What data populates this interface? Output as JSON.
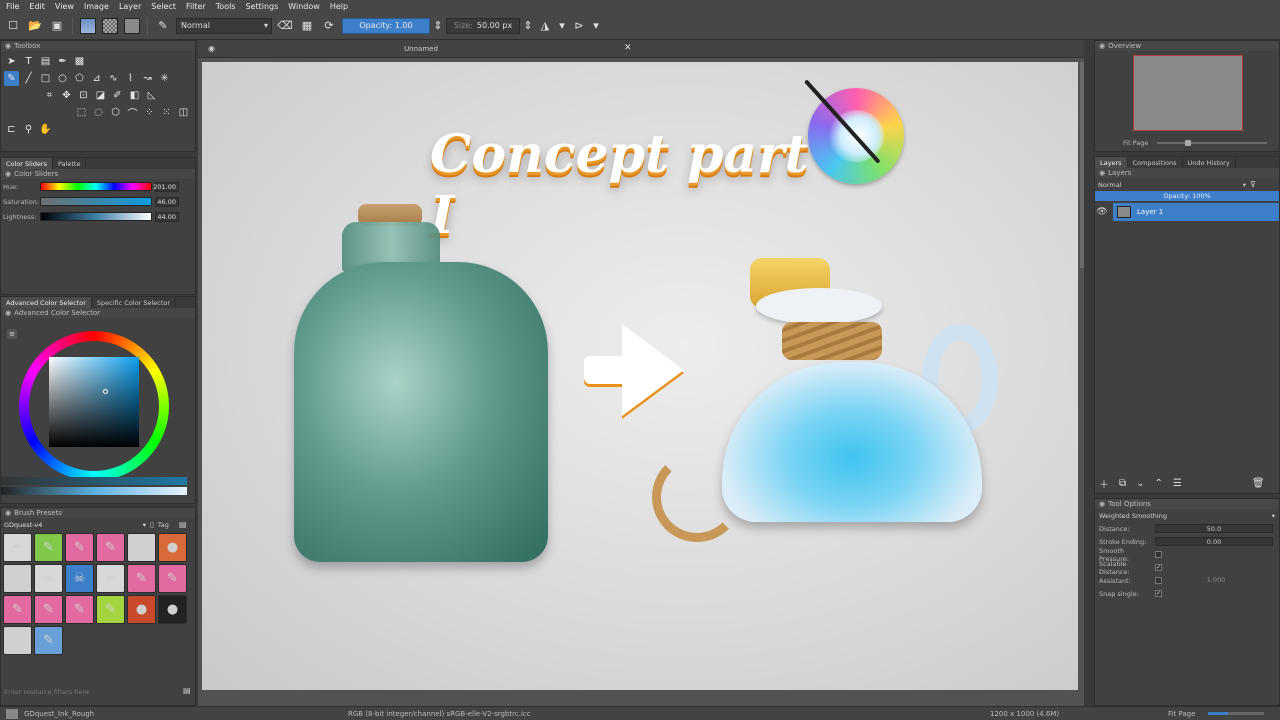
{
  "menu": [
    "File",
    "Edit",
    "View",
    "Image",
    "Layer",
    "Select",
    "Filter",
    "Tools",
    "Settings",
    "Window",
    "Help"
  ],
  "toolbar": {
    "blend_mode": "Normal",
    "opacity_label": "Opacity: 1.00",
    "size_label": "Size:",
    "size_value": "50.00 px"
  },
  "toolbox": {
    "title": "Toolbox"
  },
  "color_tabs": [
    "Color Sliders",
    "Palette"
  ],
  "color_sliders": {
    "title": "Color Sliders",
    "rows": [
      {
        "label": "Hue:",
        "value": "201.00"
      },
      {
        "label": "Saturation:",
        "value": "46.00"
      },
      {
        "label": "Lightness:",
        "value": "44.00"
      }
    ]
  },
  "selector_tabs": [
    "Advanced Color Selector",
    "Specific Color Selector"
  ],
  "advanced_selector": {
    "title": "Advanced Color Selector"
  },
  "brush_presets": {
    "title": "Brush Presets",
    "dropdown": "GDquest-v4",
    "tag_label": "Tag",
    "filter_placeholder": "Enter resource filters here"
  },
  "document": {
    "tab_title": "Unnamed"
  },
  "canvas_content": {
    "headline": "Concept part I"
  },
  "overview": {
    "title": "Overview",
    "fit_label": "Fit Page"
  },
  "right_tabs": [
    "Layers",
    "Compositions",
    "Undo History"
  ],
  "layers": {
    "title": "Layers",
    "blend_mode": "Normal",
    "opacity_label": "Opacity: 100%",
    "items": [
      {
        "name": "Layer 1"
      }
    ]
  },
  "tool_options": {
    "title": "Tool Options",
    "smoothing": "Weighted Smoothing",
    "rows": [
      {
        "label": "Distance:",
        "value": "50.0"
      },
      {
        "label": "Stroke Ending:",
        "value": "0.00"
      },
      {
        "label": "Smooth Pressure:",
        "value": ""
      },
      {
        "label": "Scalable Distance:",
        "value": ""
      },
      {
        "label": "Assistant:",
        "value": "1.000"
      },
      {
        "label": "Snap single:",
        "value": ""
      }
    ]
  },
  "status": {
    "brush": "GDquest_Ink_Rough",
    "color_profile": "RGB (8-bit integer/channel)  sRGB-elle-V2-srgbtrc.icc",
    "dimensions": "1200 x 1000 (4.6M)",
    "zoom": "Fit Page"
  },
  "colors": {
    "accent": "#3d7fc9",
    "panel": "#414141",
    "bg": "#3a3a3a"
  }
}
